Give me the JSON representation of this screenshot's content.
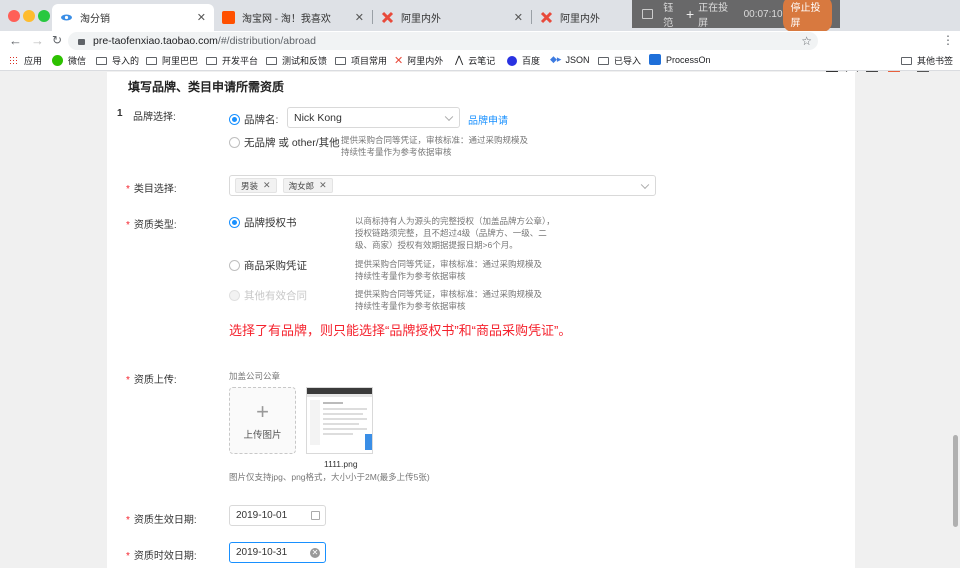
{
  "browser": {
    "tabs": [
      {
        "title": "淘分销",
        "active": true
      },
      {
        "title": "淘宝网 - 淘！我喜欢",
        "active": false
      },
      {
        "title": "阿里内外",
        "active": false
      },
      {
        "title": "阿里内外",
        "active": false
      }
    ],
    "new_tab": "+",
    "cast": {
      "user": "钰笵",
      "status": "正在投屏",
      "timer": "00:07:10",
      "stop_label": "停止投屏"
    },
    "url": {
      "host": "pre-taofenxiao.taobao.com",
      "path": "/#/distribution/abroad"
    },
    "bookmarks": [
      "应用",
      "微信",
      "导入的",
      "阿里巴巴",
      "开发平台",
      "测试和反馈",
      "项目常用",
      "阿里内外",
      "云笔记",
      "百度",
      "JSON",
      "已导入",
      "ProcessOn"
    ],
    "other_bookmarks": "其他书签",
    "colors": {
      "accent": "#1890ff",
      "required": "#f5222d",
      "stop_button": "#d8793f"
    }
  },
  "form": {
    "section_title": "填写品牌、类目申请所需资质",
    "index": "1",
    "brand": {
      "label": "品牌选择:",
      "option_brand": "品牌名:",
      "brand_value": "Nick Kong",
      "apply_link": "品牌申请",
      "option_nobrand": "无品牌 或 other/其他",
      "nobrand_help": "提供采购合同等凭证，审核标准：通过采购规模及持续性考量作为参考依据审核"
    },
    "category": {
      "required": "*",
      "label": "类目选择:",
      "tags": [
        "男装",
        "淘女郎"
      ]
    },
    "qualification": {
      "required": "*",
      "label": "资质类型:",
      "options": [
        {
          "label": "品牌授权书",
          "help": "以商标持有人为源头的完整授权（加盖品牌方公章），授权链路须完整，且不超过4级（品牌方、一级、二级、商家）授权有效期据提报日期>6个月。"
        },
        {
          "label": "商品采购凭证",
          "help": "提供采购合同等凭证，审核标准：通过采购规模及持续性考量作为参考依据审核"
        },
        {
          "label": "其他有效合同",
          "help": "提供采购合同等凭证，审核标准：通过采购规模及持续性考量作为参考依据审核"
        }
      ],
      "warning": "选择了有品牌，则只能选择“品牌授权书”和“商品采购凭证”。"
    },
    "upload": {
      "required": "*",
      "label": "资质上传:",
      "hint_top": "加盖公司公章",
      "plus": "+",
      "button": "上传图片",
      "file_name": "1111.png",
      "hint_bottom": "图片仅支持jpg、png格式，大小小于2M(最多上传5张)"
    },
    "start_date": {
      "required": "*",
      "label": "资质生效日期:",
      "value": "2019-10-01"
    },
    "end_date": {
      "required": "*",
      "label": "资质时效日期:",
      "value": "2019-10-31"
    }
  }
}
